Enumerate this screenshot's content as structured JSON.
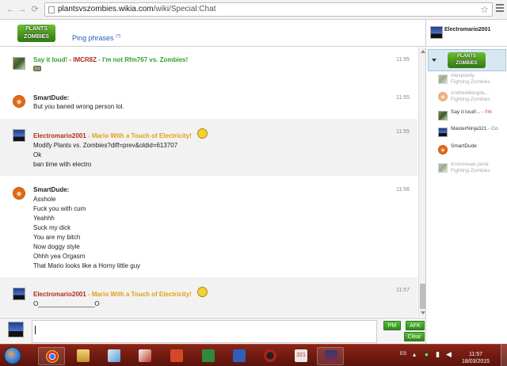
{
  "browser": {
    "url_host": "plantsvszombies.wikia.com",
    "url_path": "/wiki/Special:Chat"
  },
  "header": {
    "logo_text": "Plants vs. Zombies Wiki",
    "ping_phrases": "Ping phrases",
    "ping_count": "(?)",
    "current_user": "Electromario2001"
  },
  "messages": [
    {
      "user": "Say it loud!",
      "sep": " - ",
      "signature": "IMCR8Z",
      "signature2": " - I'm not Rfm767 vs. Zombies!",
      "time": "11:55",
      "lines": []
    },
    {
      "user": "SmartDude:",
      "time": "11:55",
      "lines": [
        "But you baned wrong person lol."
      ]
    },
    {
      "user": "Electromario2001",
      "signature": " - Mario With a Touch of Electricity!",
      "time": "11:55",
      "lines": [
        "Modify Plants vs. Zombies?diff=prev&oldid=613707",
        "Ok",
        "ban time with electro"
      ]
    },
    {
      "user": "SmartDude:",
      "time": "11:56",
      "lines": [
        "Asshole",
        "Fuck you with cum",
        "Yeahhh",
        "Suck my dick",
        "You are my bitch",
        "Now doggy style",
        "Ohhh yea Orgasm",
        "That Mario looks like a Horny little guy"
      ]
    },
    {
      "user": "Electromario2001",
      "signature": " - Mario With a Touch of Electricity!",
      "time": "11:57",
      "lines": [
        "O________________O"
      ]
    }
  ],
  "sidebar": {
    "users": [
      {
        "name": "Alexplanty",
        "status": "Fighting Zombies",
        "away": true
      },
      {
        "name": "Andreelikespla...",
        "status": "Fighting Zombies",
        "away": true
      },
      {
        "name": "Say it loud!...",
        "status": " - I'm",
        "away": false
      },
      {
        "name": "MasterNinja321",
        "status": " - Co",
        "away": false
      },
      {
        "name": "SmartDude",
        "status": "",
        "away": false
      },
      {
        "name": "Клеточная репа",
        "status": "Fighting Zombies",
        "away": true
      }
    ]
  },
  "input": {
    "pm": "PM",
    "afk": "AFK",
    "clear": "Clear"
  },
  "taskbar": {
    "lang": "ES",
    "time": "11:57",
    "date": "18/03/2015",
    "badge": "321"
  },
  "colors": {
    "green_signature": "#31a02e",
    "gold_signature": "#e0a110",
    "link_blue": "#2a4fc4",
    "button_green": "#3fa82a",
    "taskbar_red": "#7a1d12"
  }
}
